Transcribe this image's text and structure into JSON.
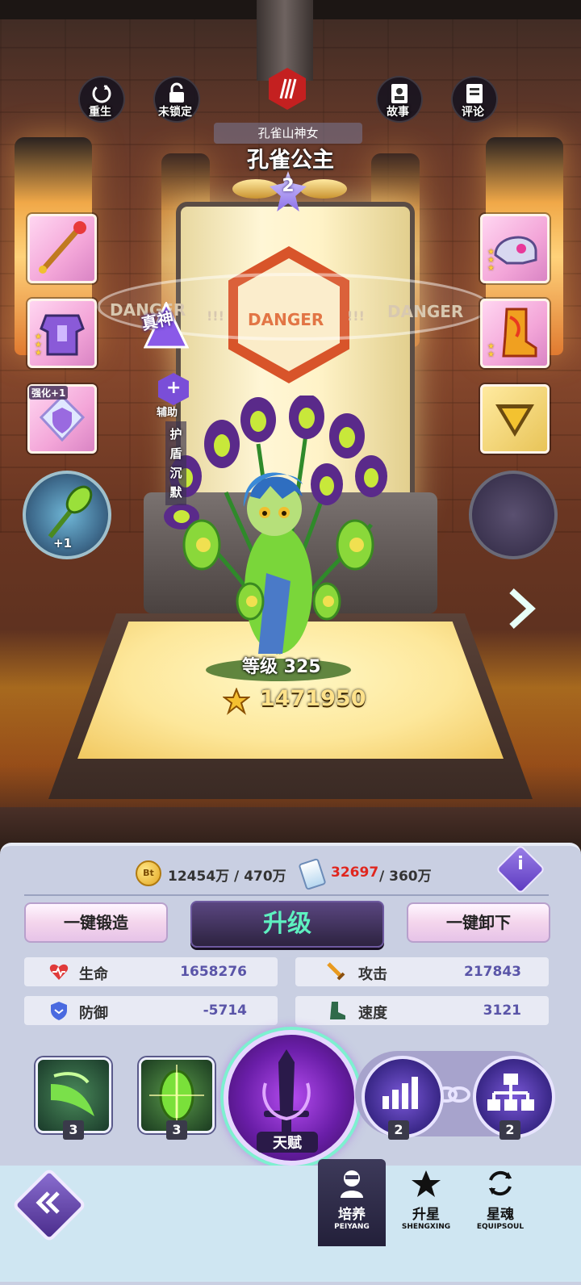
{
  "top_actions": {
    "rebirth": "重生",
    "lock": "未锁定",
    "story": "故事",
    "comments": "评论"
  },
  "hero": {
    "subtitle": "孔雀山神女",
    "name": "孔雀公主",
    "star_level": "2",
    "true_god_badge": "真神",
    "role": "辅助",
    "role_skill": "护盾沉默",
    "level_text": "等级 325",
    "power": "1471950",
    "enhance_label": "强化+1",
    "weapon_bonus": "+1"
  },
  "scene": {
    "danger_text": "DANGER",
    "danger_marks": "!!!"
  },
  "resources": {
    "gold_icon_text": "Bt",
    "gold": "12454万 / 470万",
    "exp_have": "32697",
    "exp_need": " / 360万",
    "info_label": "i",
    "colors": {
      "exp_have": "#e0261e",
      "accent": "#5ef0c0"
    }
  },
  "actions": {
    "forge_all": "一键锻造",
    "level_up": "升级",
    "unequip_all": "一键卸下"
  },
  "stats": {
    "hp_label": "生命",
    "hp_value": "1658276",
    "atk_label": "攻击",
    "atk_value": "217843",
    "def_label": "防御",
    "def_value": "-5714",
    "spd_label": "速度",
    "spd_value": "3121"
  },
  "skills": {
    "skill1_level": "3",
    "skill2_level": "3",
    "talent_label": "天赋",
    "skill3_level": "2",
    "skill4_level": "2"
  },
  "nav": {
    "back_icon": "double-chevron-left-icon",
    "items": [
      {
        "label": "培养",
        "sub": "PEIYANG"
      },
      {
        "label": "升星",
        "sub": "SHENGXING"
      },
      {
        "label": "星魂",
        "sub": "EQUIPSOUL"
      }
    ]
  }
}
